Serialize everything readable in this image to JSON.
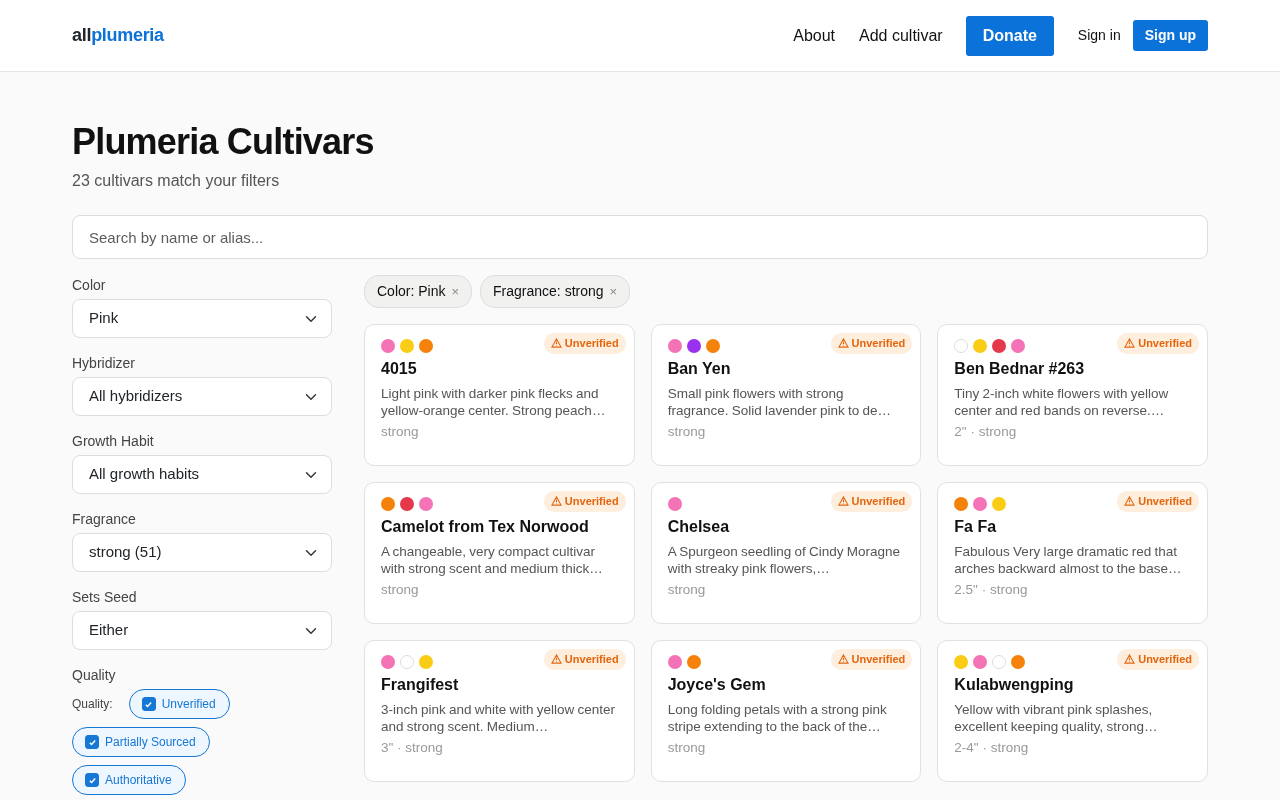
{
  "header": {
    "logo": {
      "part_1": "all",
      "part_2": "plumeria"
    },
    "nav": [
      "About",
      "Add cultivar"
    ],
    "donate": "Donate",
    "sign_in": "Sign in",
    "sign_up": "Sign up"
  },
  "title": "Plumeria Cultivars",
  "subtitle": "23 cultivars match your filters",
  "search": {
    "placeholder": "Search by name or alias..."
  },
  "filters": [
    {
      "label": "Color",
      "value": "Pink"
    },
    {
      "label": "Hybridizer",
      "value": "All hybridizers"
    },
    {
      "label": "Growth Habit",
      "value": "All growth habits"
    },
    {
      "label": "Fragrance",
      "value": "strong (51)"
    },
    {
      "label": "Sets Seed",
      "value": "Either"
    }
  ],
  "quality": {
    "heading": "Quality",
    "label": "Quality:",
    "options": [
      {
        "label": "Unverified",
        "checked": true
      },
      {
        "label": "Partially Sourced",
        "checked": true
      },
      {
        "label": "Authoritative",
        "checked": true
      }
    ]
  },
  "active_filters": [
    {
      "label": "Color: Pink",
      "remove": "×"
    },
    {
      "label": "Fragrance: strong",
      "remove": "×"
    }
  ],
  "cards": [
    {
      "colors": [
        {
          "color": "#f472b6"
        },
        {
          "color": "#facc15"
        },
        {
          "color": "#f5820b"
        }
      ],
      "badge": "Unverified",
      "name": "4015",
      "description": "Light pink with darker pink flecks and yellow-orange center. Strong peach…",
      "meta": "strong"
    },
    {
      "colors": [
        {
          "color": "#f472b6"
        },
        {
          "color": "#9b30f0"
        },
        {
          "color": "#f5820b"
        }
      ],
      "badge": "Unverified",
      "name": "Ban Yen",
      "description": "Small pink flowers with strong fragrance. Solid lavender pink to de…",
      "meta": "strong"
    },
    {
      "colors": [
        {
          "color": "#ffffff"
        },
        {
          "color": "#facc15"
        },
        {
          "color": "#e5384a"
        },
        {
          "color": "#f472b6"
        }
      ],
      "badge": "Unverified",
      "name": "Ben Bednar #263",
      "description": "Tiny 2-inch white flowers with yellow center and red bands on reverse.…",
      "meta": "2\" · strong"
    },
    {
      "colors": [
        {
          "color": "#f5820b"
        },
        {
          "color": "#e5384a"
        },
        {
          "color": "#f472b6"
        }
      ],
      "badge": "Unverified",
      "name": "Camelot from Tex Norwood",
      "description": "A changeable, very compact cultivar with strong scent and medium thick…",
      "meta": "strong"
    },
    {
      "colors": [
        {
          "color": "#f472b6"
        }
      ],
      "badge": "Unverified",
      "name": "Chelsea",
      "description": "A Spurgeon seedling of Cindy Moragne with streaky pink flowers,…",
      "meta": "strong"
    },
    {
      "colors": [
        {
          "color": "#f5820b"
        },
        {
          "color": "#f472b6"
        },
        {
          "color": "#facc15"
        }
      ],
      "badge": "Unverified",
      "name": "Fa Fa",
      "description": "Fabulous Very large dramatic red that arches backward almost to the base…",
      "meta": "2.5\" · strong"
    },
    {
      "colors": [
        {
          "color": "#f472b6"
        },
        {
          "color": "#ffffff"
        },
        {
          "color": "#facc15"
        }
      ],
      "badge": "Unverified",
      "name": "Frangifest",
      "description": "3-inch pink and white with yellow center and strong scent. Medium…",
      "meta": "3\" · strong"
    },
    {
      "colors": [
        {
          "color": "#f472b6"
        },
        {
          "color": "#f5820b"
        }
      ],
      "badge": "Unverified",
      "name": "Joyce's Gem",
      "description": "Long folding petals with a strong pink stripe extending to the back of the…",
      "meta": "strong"
    },
    {
      "colors": [
        {
          "color": "#facc15"
        },
        {
          "color": "#f472b6"
        },
        {
          "color": "#ffffff"
        },
        {
          "color": "#f5820b"
        }
      ],
      "badge": "Unverified",
      "name": "Kulabwengping",
      "description": "Yellow with vibrant pink splashes, excellent keeping quality, strong…",
      "meta": "2-4\" · strong"
    }
  ]
}
